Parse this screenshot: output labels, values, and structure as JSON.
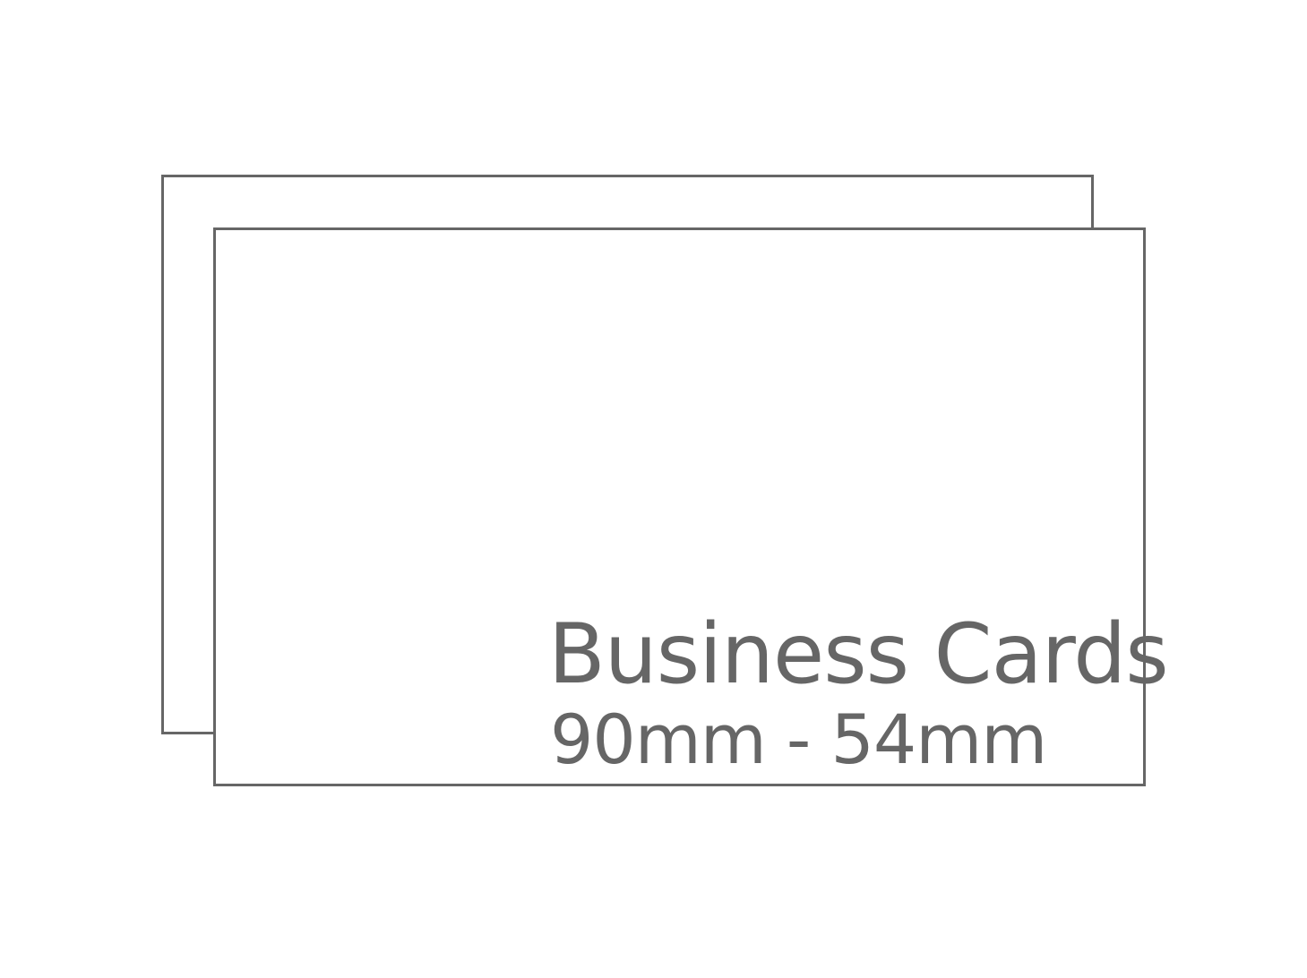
{
  "colors": {
    "outline": "#666666",
    "text": "#666666",
    "background": "#ffffff"
  },
  "card": {
    "title": "Business Cards",
    "dimensions": "90mm - 54mm"
  }
}
